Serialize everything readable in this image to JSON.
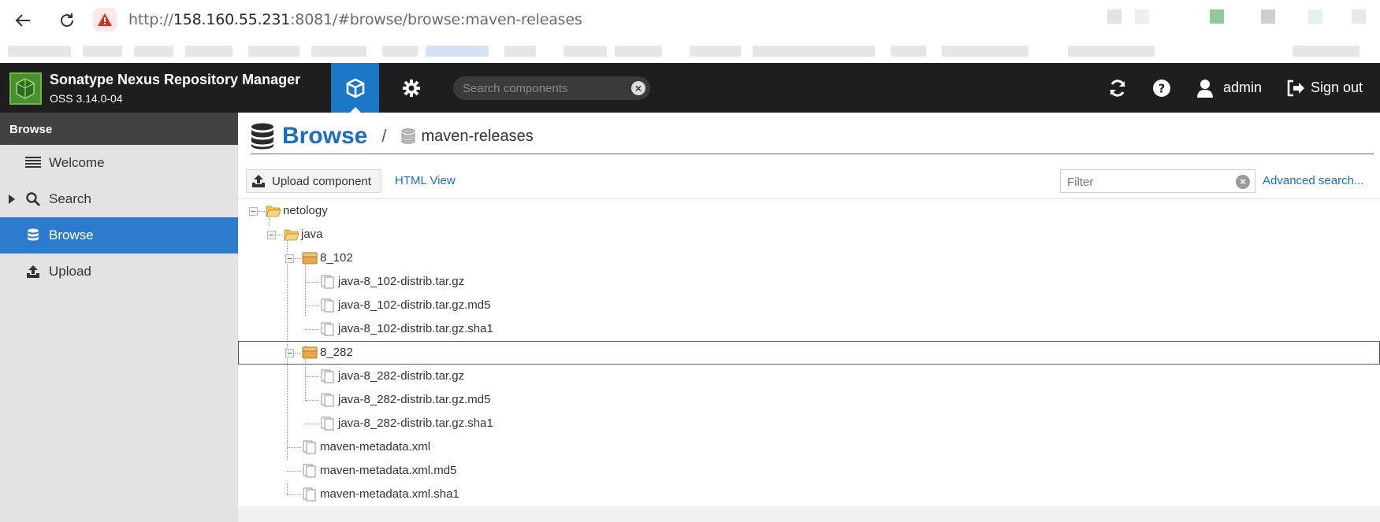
{
  "browser": {
    "url_prefix": "http://",
    "url_host": "158.160.55.231",
    "url_rest": ":8081/#browse/browse:maven-releases"
  },
  "header": {
    "app_name": "Sonatype Nexus Repository Manager",
    "version": "OSS 3.14.0-04",
    "search_placeholder": "Search components",
    "user": "admin",
    "signout": "Sign out"
  },
  "sidebar": {
    "title": "Browse",
    "items": [
      {
        "label": "Welcome",
        "icon": "list-icon"
      },
      {
        "label": "Search",
        "icon": "search-icon"
      },
      {
        "label": "Browse",
        "icon": "database-icon"
      },
      {
        "label": "Upload",
        "icon": "upload-icon"
      }
    ]
  },
  "main": {
    "title": "Browse",
    "repository": "maven-releases",
    "upload_button": "Upload component",
    "html_view": "HTML View",
    "filter_placeholder": "Filter",
    "advanced_search": "Advanced search..."
  },
  "tree": [
    {
      "label": "netology",
      "type": "folder"
    },
    {
      "label": "java",
      "type": "folder"
    },
    {
      "label": "8_102",
      "type": "component"
    },
    {
      "label": "java-8_102-distrib.tar.gz",
      "type": "asset"
    },
    {
      "label": "java-8_102-distrib.tar.gz.md5",
      "type": "asset"
    },
    {
      "label": "java-8_102-distrib.tar.gz.sha1",
      "type": "asset"
    },
    {
      "label": "8_282",
      "type": "component",
      "selected": true
    },
    {
      "label": "java-8_282-distrib.tar.gz",
      "type": "asset"
    },
    {
      "label": "java-8_282-distrib.tar.gz.md5",
      "type": "asset"
    },
    {
      "label": "java-8_282-distrib.tar.gz.sha1",
      "type": "asset"
    },
    {
      "label": "maven-metadata.xml",
      "type": "asset"
    },
    {
      "label": "maven-metadata.xml.md5",
      "type": "asset"
    },
    {
      "label": "maven-metadata.xml.sha1",
      "type": "asset"
    }
  ]
}
